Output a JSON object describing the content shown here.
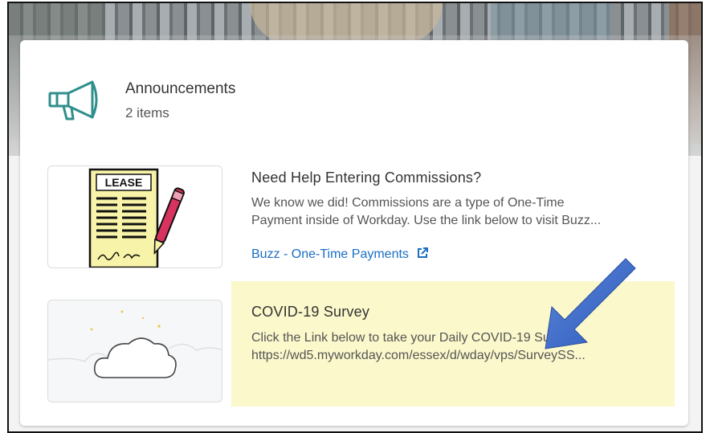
{
  "announcements": {
    "title": "Announcements",
    "count_label": "2 items",
    "icon": "megaphone-icon"
  },
  "items": [
    {
      "title": "Need Help Entering Commissions?",
      "line1": "We know we did! Commissions are a type of One-Time",
      "line2": "Payment inside of Workday. Use the link below to visit Buzz...",
      "link_label": "Buzz - One-Time Payments",
      "thumbnail": {
        "sign_text": "LEASE",
        "icon": "lease-document-icon"
      }
    },
    {
      "title": "COVID-19 Survey",
      "line1": "Click the Link below to take your Daily COVID-19 Survey",
      "line2": "https://wd5.myworkday.com/essex/d/wday/vps/SurveySS...",
      "thumbnail": {
        "icon": "cloud-icon"
      },
      "highlight_color": "#fbf8cb"
    }
  ],
  "colors": {
    "accent_teal": "#2f8f8c",
    "link_blue": "#1a6fc4",
    "annotation_arrow": "#3a67c8"
  }
}
